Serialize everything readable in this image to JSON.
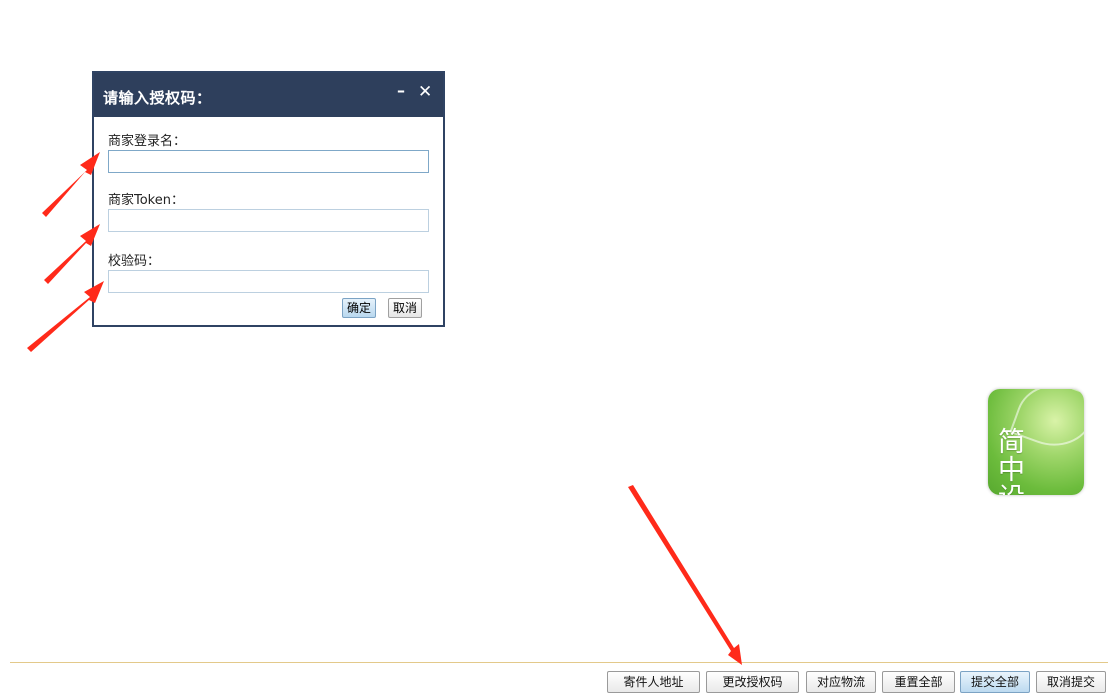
{
  "dialog": {
    "title": "请输入授权码：",
    "minimize_glyph": "–",
    "close_glyph": "✕",
    "fields": [
      {
        "label": "商家登录名：",
        "value": "",
        "placeholder": ""
      },
      {
        "label": "商家Token：",
        "value": "",
        "placeholder": ""
      },
      {
        "label": "校验码：",
        "value": "",
        "placeholder": ""
      }
    ],
    "ok_label": "确定",
    "cancel_label": "取消"
  },
  "logo": {
    "text": "简中设"
  },
  "toolbar": {
    "buttons": [
      {
        "label": "寄件人地址"
      },
      {
        "label": "更改授权码"
      },
      {
        "label": "对应物流"
      },
      {
        "label": "重置全部"
      },
      {
        "label": "提交全部"
      },
      {
        "label": "取消提交"
      }
    ]
  },
  "colors": {
    "dialog_header": "#2e3f5c",
    "annotation_arrow": "#ff2a1a",
    "divider": "#e3c98a",
    "primary_button": "#bcdaf0"
  },
  "icons": [
    "minimize-icon",
    "close-icon",
    "arrow-annotation"
  ]
}
